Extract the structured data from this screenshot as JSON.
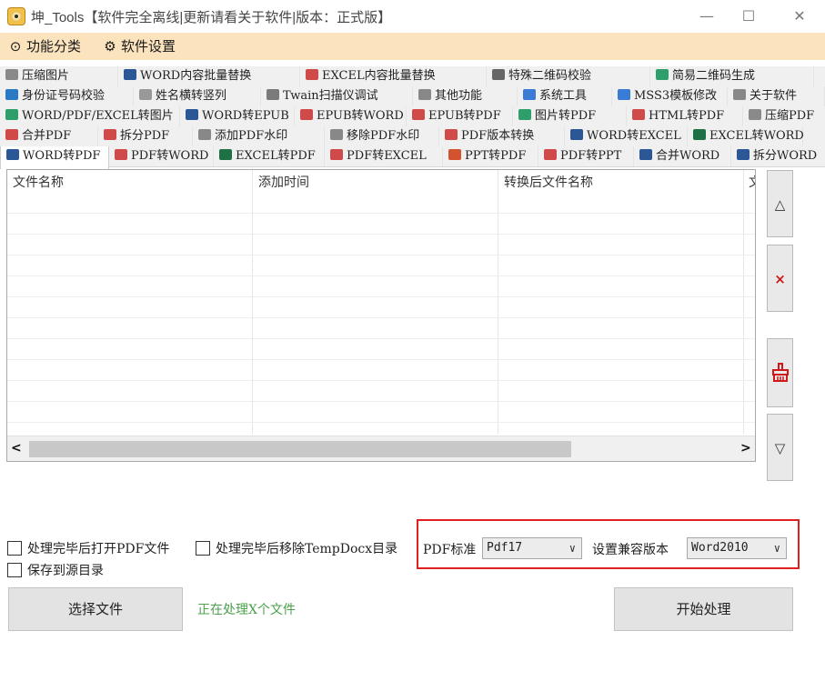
{
  "window": {
    "title": "坤_Tools【软件完全离线|更新请看关于软件|版本：正式版】",
    "minimize_glyph": "—",
    "maximize_glyph": "☐",
    "close_glyph": "✕"
  },
  "menu": [
    {
      "icon": "category-icon",
      "glyph": "⊙",
      "label": "功能分类"
    },
    {
      "icon": "gear-icon",
      "glyph": "⚙",
      "label": "软件设置"
    }
  ],
  "tab_rows": [
    [
      {
        "label": "压缩图片",
        "icon": "compress-icon",
        "color": "#8a8a8a"
      },
      {
        "label": "WORD内容批量替换",
        "icon": "word-icon",
        "color": "#2b5797"
      },
      {
        "label": "EXCEL内容批量替换",
        "icon": "doc-icon",
        "color": "#d04a4a"
      },
      {
        "label": "特殊二维码校验",
        "icon": "qrcode-icon",
        "color": "#666666"
      },
      {
        "label": "简易二维码生成",
        "icon": "qrcode-icon",
        "color": "#2e9e6b"
      }
    ],
    [
      {
        "label": "身份证号码校验",
        "icon": "idcard-icon",
        "color": "#2b79c2"
      },
      {
        "label": "姓名横转竖列",
        "icon": "list-icon",
        "color": "#999999"
      },
      {
        "label": "Twain扫描仪调试",
        "icon": "scanner-icon",
        "color": "#7a7a7a"
      },
      {
        "label": "其他功能",
        "icon": "more-icon",
        "color": "#888888"
      },
      {
        "label": "系统工具",
        "icon": "tools-icon",
        "color": "#3a7bd5"
      },
      {
        "label": "MSS3模板修改",
        "icon": "tools-icon",
        "color": "#3a7bd5"
      },
      {
        "label": "关于软件",
        "icon": "info-icon",
        "color": "#888888"
      }
    ],
    [
      {
        "label": "WORD/PDF/EXCEL转图片",
        "icon": "image-icon",
        "color": "#2e9e6b"
      },
      {
        "label": "WORD转EPUB",
        "icon": "word-icon",
        "color": "#2b5797"
      },
      {
        "label": "EPUB转WORD",
        "icon": "epub-icon",
        "color": "#d04a4a"
      },
      {
        "label": "EPUB转PDF",
        "icon": "epub-icon",
        "color": "#d04a4a"
      },
      {
        "label": "图片转PDF",
        "icon": "image-icon",
        "color": "#2e9e6b"
      },
      {
        "label": "HTML转PDF",
        "icon": "doc-icon",
        "color": "#d04a4a"
      },
      {
        "label": "压缩PDF",
        "icon": "compress-icon",
        "color": "#8a8a8a"
      }
    ],
    [
      {
        "label": "合并PDF",
        "icon": "doc-icon",
        "color": "#d04a4a"
      },
      {
        "label": "拆分PDF",
        "icon": "doc-icon",
        "color": "#d04a4a"
      },
      {
        "label": "添加PDF水印",
        "icon": "watermark-icon",
        "color": "#888888"
      },
      {
        "label": "移除PDF水印",
        "icon": "watermark-icon",
        "color": "#888888"
      },
      {
        "label": "PDF版本转换",
        "icon": "doc-icon",
        "color": "#d04a4a"
      },
      {
        "label": "WORD转EXCEL",
        "icon": "word-icon",
        "color": "#2b5797"
      },
      {
        "label": "EXCEL转WORD",
        "icon": "excel-icon",
        "color": "#1e7145"
      }
    ],
    [
      {
        "label": "WORD转PDF",
        "icon": "word-icon",
        "color": "#2b5797"
      },
      {
        "label": "PDF转WORD",
        "icon": "doc-icon",
        "color": "#d04a4a"
      },
      {
        "label": "EXCEL转PDF",
        "icon": "excel-icon",
        "color": "#1e7145"
      },
      {
        "label": "PDF转EXCEL",
        "icon": "doc-icon",
        "color": "#d04a4a"
      },
      {
        "label": "PPT转PDF",
        "icon": "ppt-icon",
        "color": "#d35230"
      },
      {
        "label": "PDF转PPT",
        "icon": "doc-icon",
        "color": "#d04a4a"
      },
      {
        "label": "合并WORD",
        "icon": "word-icon",
        "color": "#2b5797"
      },
      {
        "label": "拆分WORD",
        "icon": "word-icon",
        "color": "#2b5797"
      }
    ]
  ],
  "active_tab": "WORD转PDF",
  "file_table": {
    "columns": [
      "文件名称",
      "添加时间",
      "转换后文件名称",
      "文"
    ],
    "rows": []
  },
  "side_buttons": [
    {
      "name": "move-up",
      "glyph": "△"
    },
    {
      "name": "remove",
      "glyph": "×"
    },
    {
      "name": "clear",
      "glyph": "🧹"
    },
    {
      "name": "move-down",
      "glyph": "▽"
    }
  ],
  "scrollbar": {
    "left": "<",
    "right": ">"
  },
  "options": {
    "open_pdf_after": "处理完毕后打开PDF文件",
    "remove_temp_after": "处理完毕后移除TempDocx目录",
    "save_to_source": "保存到源目录"
  },
  "pdf_standard": {
    "label": "PDF标准",
    "value": "Pdf17"
  },
  "compat_version": {
    "label": "设置兼容版本",
    "value": "Word2010"
  },
  "select_files_label": "选择文件",
  "status_text": "正在处理X个文件",
  "start_label": "开始处理",
  "colors": {
    "accent_menu": "#fbe3bd",
    "highlight": "#e02020",
    "status": "#4aa24a"
  }
}
